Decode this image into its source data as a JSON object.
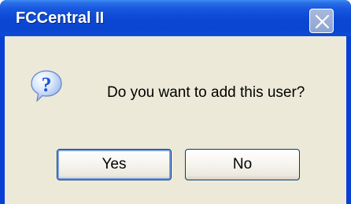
{
  "window": {
    "title": "FCCentral II",
    "close_icon": "close-icon"
  },
  "dialog": {
    "icon": "question-icon",
    "message": "Do you want to add this user?"
  },
  "buttons": {
    "yes_label": "Yes",
    "no_label": "No",
    "default": "Yes"
  },
  "colors": {
    "titlebar": "#0a45d0",
    "client_background": "#ece9d8",
    "button_border": "#003c74",
    "icon_blue": "#1b58d6"
  }
}
